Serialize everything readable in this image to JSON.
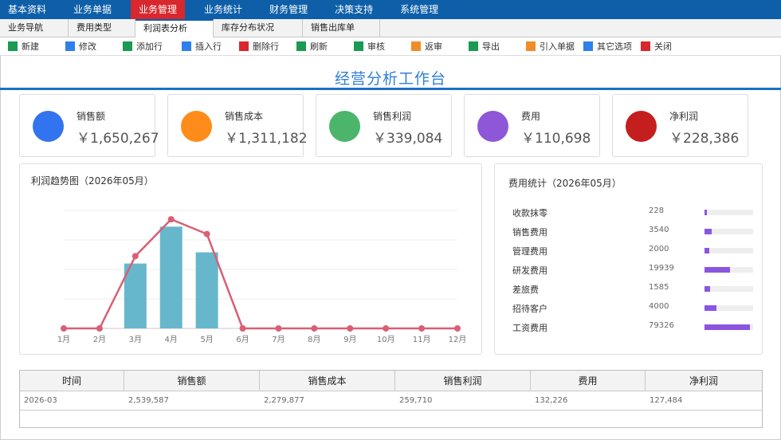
{
  "menu": [
    "基本资料",
    "业务单据",
    "业务管理",
    "业务统计",
    "财务管理",
    "决策支持",
    "系统管理"
  ],
  "menu_active": 2,
  "tabs": [
    "业务导航",
    "费用类型",
    "利润表分析",
    "库存分布状况",
    "销售出库单"
  ],
  "tab_active": 2,
  "toolbar": [
    {
      "label": "新建",
      "color": "#1a9a52",
      "icon": "new-icon"
    },
    {
      "label": "修改",
      "color": "#2f80ed",
      "icon": "edit-icon"
    },
    {
      "label": "添加行",
      "color": "#1a9a52",
      "icon": "add-row-icon"
    },
    {
      "label": "插入行",
      "color": "#2f80ed",
      "icon": "insert-row-icon"
    },
    {
      "label": "删除行",
      "color": "#d9272e",
      "icon": "delete-row-icon"
    },
    {
      "label": "刷新",
      "color": "#1a9a52",
      "icon": "refresh-icon"
    },
    {
      "label": "审核",
      "color": "#1a9a52",
      "icon": "audit-icon"
    },
    {
      "label": "返审",
      "color": "#f08c2a",
      "icon": "unaudit-icon"
    },
    {
      "label": "导出",
      "color": "#1a9a52",
      "icon": "export-icon"
    },
    {
      "label": "引入单据",
      "color": "#f08c2a",
      "icon": "import-icon"
    },
    {
      "label": "其它选项",
      "color": "#2f80ed",
      "icon": "options-icon"
    },
    {
      "label": "关闭",
      "color": "#d9272e",
      "icon": "close-icon"
    }
  ],
  "page_title": "经营分析工作台",
  "kpis": [
    {
      "label": "销售额",
      "value": "￥1,650,267",
      "color": "#3274f0"
    },
    {
      "label": "销售成本",
      "value": "￥1,311,182",
      "color": "#ff8c1a"
    },
    {
      "label": "销售利润",
      "value": "￥339,084",
      "color": "#4bb56b"
    },
    {
      "label": "费用",
      "value": "￥110,698",
      "color": "#8e57d8"
    },
    {
      "label": "净利润",
      "value": "￥228,386",
      "color": "#c41e1e"
    }
  ],
  "trend_title": "利润趋势图（2026年05月）",
  "cost_title": "费用统计（2026年05月）",
  "cost_items": [
    {
      "name": "收款抹零",
      "value": "228",
      "ratio": 0.05
    },
    {
      "name": "销售费用",
      "value": "3540",
      "ratio": 0.15
    },
    {
      "name": "管理费用",
      "value": "2000",
      "ratio": 0.1
    },
    {
      "name": "研发费用",
      "value": "19939",
      "ratio": 0.52
    },
    {
      "name": "差旅费",
      "value": "1585",
      "ratio": 0.12
    },
    {
      "name": "招待客户",
      "value": "4000",
      "ratio": 0.25
    },
    {
      "name": "工资费用",
      "value": "79326",
      "ratio": 0.93
    }
  ],
  "table": {
    "headers": [
      "时间",
      "销售额",
      "销售成本",
      "销售利润",
      "费用",
      "净利润"
    ],
    "rows": [
      [
        "2026-03",
        "2,539,587",
        "2,279,877",
        "259,710",
        "132,226",
        "127,484"
      ]
    ]
  },
  "chart_data": {
    "type": "bar",
    "title": "利润趋势图（2026年05月）",
    "categories": [
      "1月",
      "2月",
      "3月",
      "4月",
      "5月",
      "6月",
      "7月",
      "8月",
      "9月",
      "10月",
      "11月",
      "12月"
    ],
    "series": [
      {
        "type": "bar",
        "values": [
          0,
          0,
          220000,
          345000,
          258000,
          0,
          0,
          0,
          0,
          0,
          0,
          0
        ],
        "color": "#67b7cc"
      },
      {
        "type": "line",
        "values": [
          0,
          0,
          245000,
          370000,
          320000,
          0,
          0,
          0,
          0,
          0,
          0,
          0
        ],
        "color": "#d95f75"
      }
    ],
    "ylim": [
      0,
      400000
    ],
    "grid": true
  }
}
